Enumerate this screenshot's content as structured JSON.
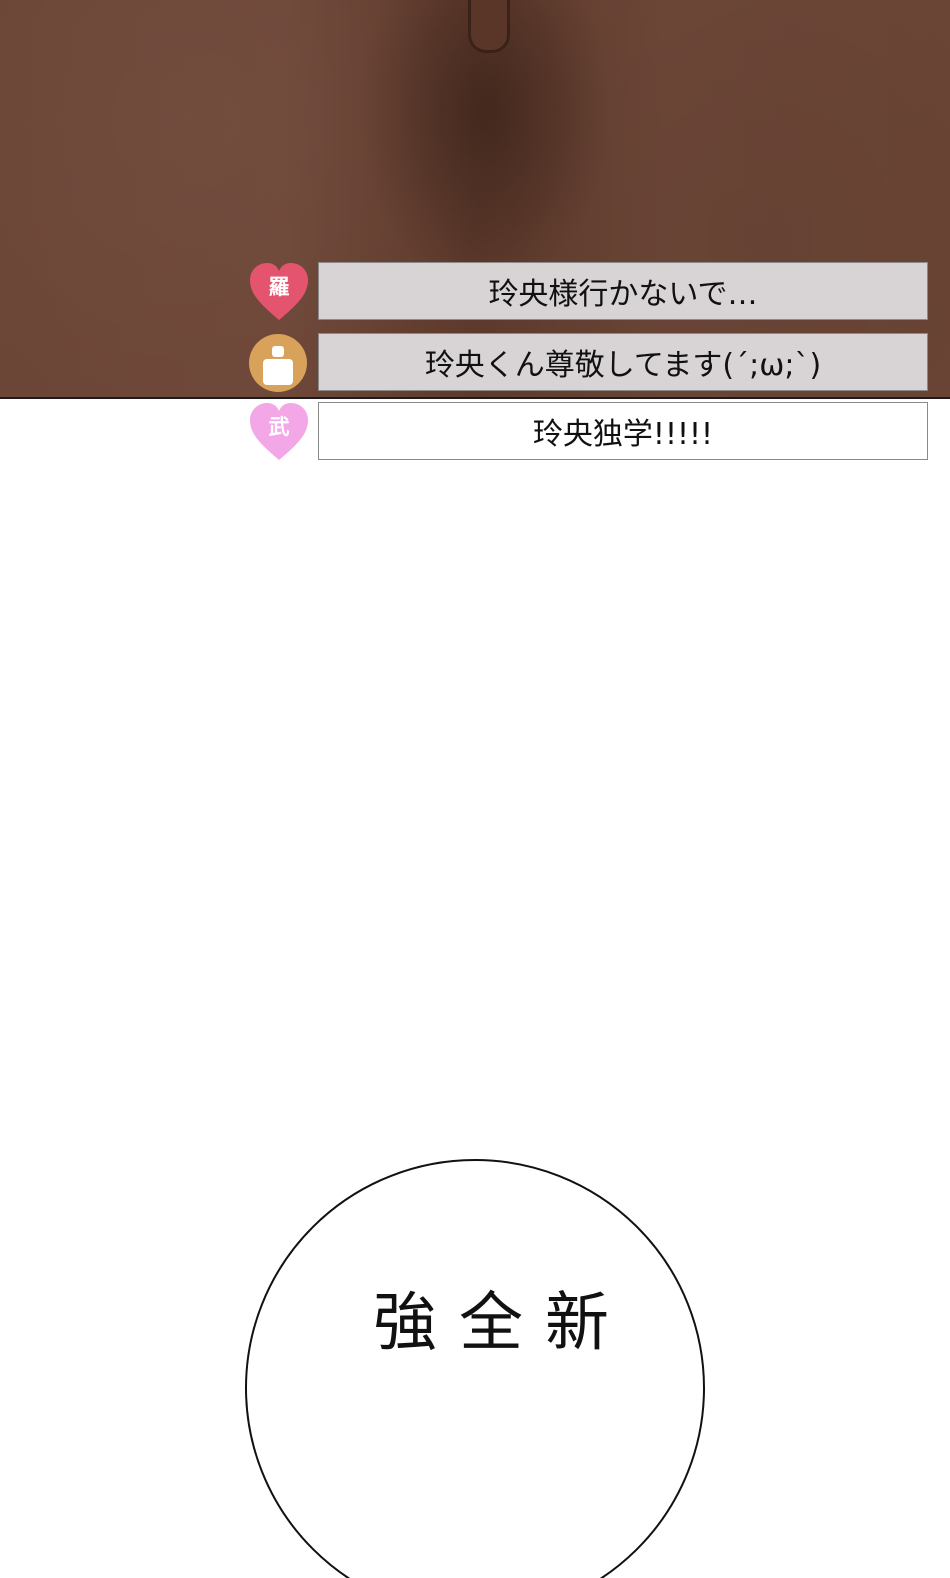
{
  "comments": [
    {
      "avatar_char": "羅",
      "avatar_shape": "heart",
      "avatar_color": "#e4546e",
      "text": "玲央様行かないで…",
      "box_style": "gray"
    },
    {
      "avatar_char": "",
      "avatar_shape": "circle-person",
      "avatar_color": "#d9a25b",
      "text": "玲央くん尊敬してます(´;ω;`)",
      "box_style": "gray"
    },
    {
      "avatar_char": "武",
      "avatar_shape": "heart",
      "avatar_color": "#f4a7e6",
      "text": "玲央独学!!!!!",
      "box_style": "white"
    }
  ],
  "speech_bubble": {
    "columns": [
      "新",
      "全",
      "強"
    ]
  }
}
